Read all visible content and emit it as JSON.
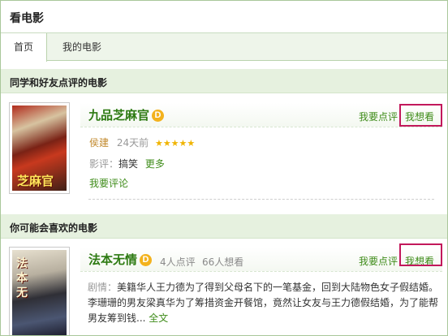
{
  "header": {
    "title": "看电影"
  },
  "tabs": [
    {
      "label": "首页",
      "active": true
    },
    {
      "label": "我的电影",
      "active": false
    }
  ],
  "sections": {
    "friends": {
      "label": "同学和好友点评的电影"
    },
    "recommend": {
      "label": "你可能会喜欢的电影"
    }
  },
  "movie1": {
    "title": "九品芝麻官",
    "badge": "D",
    "action_review": "我要点评",
    "action_want": "我想看",
    "author": "侯建",
    "time": "24天前",
    "stars": "★★★★★",
    "review_label": "影评：",
    "review_tag": "搞笑",
    "review_more": "更多",
    "my_review": "我要评论",
    "poster_text": "芝麻官"
  },
  "movie2": {
    "title": "法本无情",
    "badge": "D",
    "review_count": "4人点评",
    "want_count": "66人想看",
    "action_review": "我要点评",
    "action_want": "我想看",
    "plot_label": "剧情：",
    "plot": "美籍华人王力德为了得到父母名下的一笔基金，回到大陆物色女子假结婚。李珊珊的男友梁真华为了筹措资金开餐馆，竟然让女友与王力德假结婚，为了能帮男友筹到钱...",
    "full_text": "全文",
    "poster_text": "法本无"
  },
  "colors": {
    "brand_green": "#3f8c1a",
    "highlight_box": "#c2185b",
    "section_bg": "#e6f1df"
  }
}
